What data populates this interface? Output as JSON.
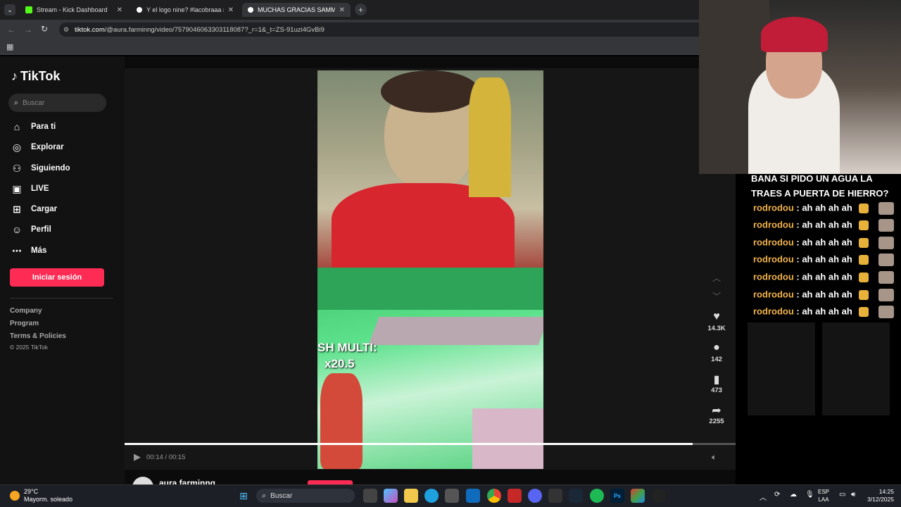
{
  "browser": {
    "tabs": [
      {
        "label": "Stream - Kick Dashboard",
        "color": "#53fc18"
      },
      {
        "label": "Y el logo nine? #lacobraaa #da",
        "color": "#ffffff"
      },
      {
        "label": "MUCHAS GRACIAS SAMMY PO",
        "color": "#ffffff"
      }
    ],
    "url_host": "tiktok.com",
    "url_path": "/@aura.farminng/video/7579046063303118087?_r=1&_t=ZS-91uzi4GvBi9"
  },
  "tiktok": {
    "brand": "TikTok",
    "search_placeholder": "Buscar",
    "nav": [
      {
        "label": "Para ti",
        "icon": "home-icon"
      },
      {
        "label": "Explorar",
        "icon": "compass-icon"
      },
      {
        "label": "Siguiendo",
        "icon": "following-icon"
      },
      {
        "label": "LIVE",
        "icon": "live-icon"
      },
      {
        "label": "Cargar",
        "icon": "upload-icon"
      },
      {
        "label": "Perfil",
        "icon": "profile-icon"
      },
      {
        "label": "Más",
        "icon": "more-icon"
      }
    ],
    "login_label": "Iniciar sesión",
    "footer": [
      "Company",
      "Program",
      "Terms & Policies"
    ],
    "copyright": "© 2025 TikTok",
    "video": {
      "time": "00:14 / 00:15",
      "progress": 0.93,
      "overlay_line1": "SH MULTI:",
      "overlay_line2": "x20.5",
      "author": "aura.farminng"
    },
    "actions": {
      "likes": "14.3K",
      "comments": "142",
      "saves": "473",
      "shares": "2255"
    }
  },
  "chat": {
    "top_text": "BANA SI PIDO UN AGUA LA TRAES A PUERTA DE HIERRO?",
    "messages": [
      {
        "user": "rodrodou",
        "text": ": ah ah ah ah"
      },
      {
        "user": "rodrodou",
        "text": ": ah ah ah ah"
      },
      {
        "user": "rodrodou",
        "text": ": ah ah ah ah"
      },
      {
        "user": "rodrodou",
        "text": ": ah ah ah ah"
      },
      {
        "user": "rodrodou",
        "text": ": ah ah ah ah"
      },
      {
        "user": "rodrodou",
        "text": ": ah ah ah ah"
      },
      {
        "user": "rodrodou",
        "text": ": ah ah ah ah"
      }
    ]
  },
  "taskbar": {
    "temp": "29°C",
    "weather": "Mayorm. soleado",
    "search": "Buscar",
    "lang1": "ESP",
    "lang2": "LAA",
    "time": "14:25",
    "date": "3/12/2025"
  }
}
